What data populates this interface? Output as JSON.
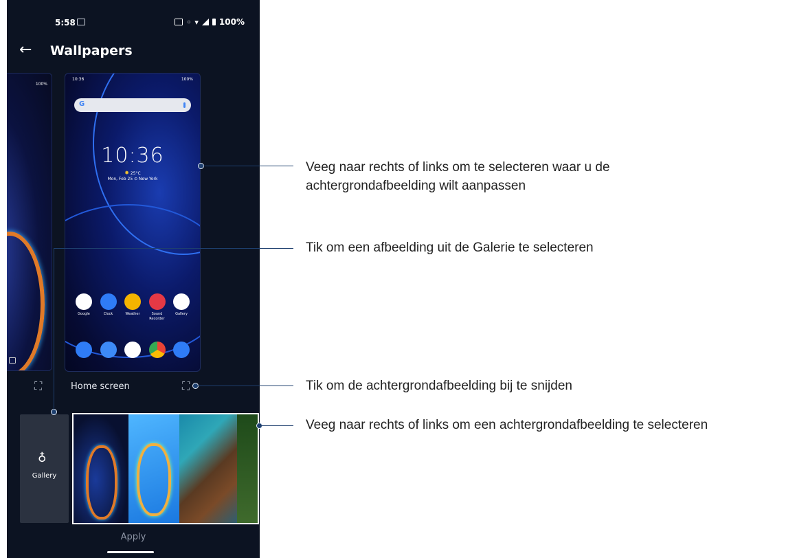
{
  "status": {
    "time": "5:58",
    "battery": "100%"
  },
  "appbar": {
    "title": "Wallpapers",
    "back_icon": "arrow-left-icon"
  },
  "preview_left": {
    "battery": "100%"
  },
  "preview_home": {
    "status_time": "10:36",
    "status_battery": "100%",
    "search_logo": "G",
    "clock": "10:36",
    "weather": "25°C",
    "date": "Mon, Feb 25",
    "location": "New York",
    "apps": [
      {
        "label": "Google",
        "color": "#ffffff"
      },
      {
        "label": "Clock",
        "color": "#2f7cf6"
      },
      {
        "label": "Weather",
        "color": "#f4b400"
      },
      {
        "label": "Sound Recorder",
        "color": "#e53945"
      },
      {
        "label": "Gallery",
        "color": "#ffffff"
      }
    ],
    "dock": [
      {
        "icon": "phone-icon",
        "color": "#2f7cf6"
      },
      {
        "icon": "messages-icon",
        "color": "#3d8af7"
      },
      {
        "icon": "play-store-icon",
        "color": "#ffffff"
      },
      {
        "icon": "chrome-icon",
        "color": "#e8e8e8"
      },
      {
        "icon": "camera-icon",
        "color": "#2f7cf6"
      }
    ],
    "label": "Home screen"
  },
  "gallery": {
    "label": "Gallery",
    "icon": "balloon-icon"
  },
  "apply_label": "Apply",
  "annotations": [
    "Veeg naar rechts of links om te selecteren waar u de\nachtergrondafbeelding wilt aanpassen",
    "Tik om een afbeelding uit de Galerie te selecteren",
    "Tik om de achtergrondafbeelding bij te snijden",
    "Veeg naar rechts of links om een achtergrondafbeelding te selecteren"
  ]
}
